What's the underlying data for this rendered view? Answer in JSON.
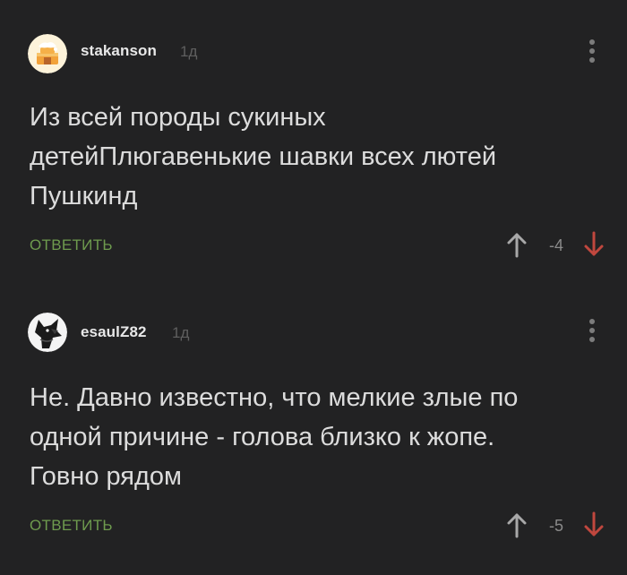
{
  "colors": {
    "background": "#222223",
    "username": "#e8e8e8",
    "time": "#5f5f5f",
    "text": "#dcdcdc",
    "reply": "#6e9b4e",
    "rating": "#8a8a8a",
    "upvote_icon": "#a8a8a8",
    "downvote_icon": "#c0473e"
  },
  "comments": [
    {
      "username": "stakanson",
      "time": "1д",
      "avatar_icon": "cake-avatar-icon",
      "text": "Из всей породы сукиных\nдетейПлюгавенькие шавки всех лютей\nПушкинд",
      "reply_label": "ОТВЕТИТЬ",
      "rating": "-4",
      "menu_icon": "more-vertical-icon",
      "upvote_icon": "arrow-up-icon",
      "downvote_icon": "arrow-down-icon"
    },
    {
      "username": "esaulZ82",
      "time": "1д",
      "avatar_icon": "wolf-avatar-icon",
      "text": "Не. Давно известно, что мелкие злые по\nодной причине - голова близко к жопе.\nГовно рядом",
      "reply_label": "ОТВЕТИТЬ",
      "rating": "-5",
      "menu_icon": "more-vertical-icon",
      "upvote_icon": "arrow-up-icon",
      "downvote_icon": "arrow-down-icon"
    }
  ]
}
